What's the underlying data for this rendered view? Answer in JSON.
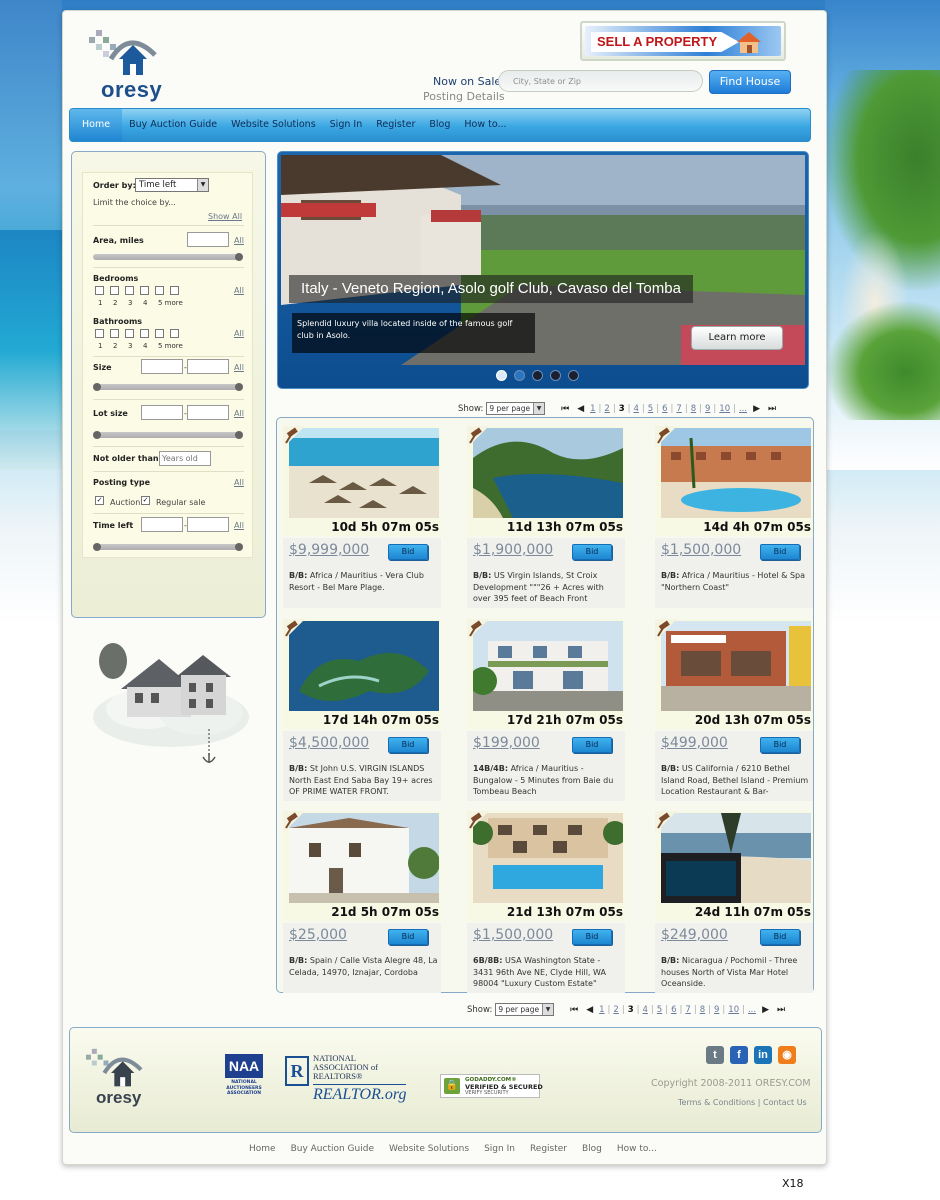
{
  "header": {
    "logo_text": "oresy",
    "sell_banner": "SELL A PROPERTY",
    "now_on_sale": "Now on Sale",
    "posting_details": "Posting Details",
    "search_placeholder": "City, State or Zip",
    "find_button": "Find House"
  },
  "nav": [
    "Home",
    "Buy Auction Guide",
    "Website Solutions",
    "Sign In",
    "Register",
    "Blog",
    "How to..."
  ],
  "filters": {
    "order_by_label": "Order by:",
    "order_by_value": "Time left",
    "limit_text": "Limit the choice by...",
    "show_all": "Show All",
    "area_label": "Area, miles",
    "all": "All",
    "bedrooms_label": "Bedrooms",
    "bathrooms_label": "Bathrooms",
    "count_nums": [
      "1",
      "2",
      "3",
      "4",
      "5 more"
    ],
    "size_label": "Size",
    "lot_size_label": "Lot size",
    "not_older_label": "Not older than:",
    "not_older_placeholder": "Years old",
    "posting_type_label": "Posting type",
    "auction_label": "Auction",
    "regular_label": "Regular sale",
    "time_left_label": "Time left",
    "dash": "-"
  },
  "hero": {
    "caption": "Italy - Veneto Region, Asolo golf Club, Cavaso del Tomba",
    "description": "Splendid luxury villa located inside of the famous golf club in Asolo.",
    "button": "Learn more",
    "slide_count": 5,
    "active_slide": 1
  },
  "pager": {
    "show_label": "Show:",
    "per_page": "9 per page",
    "first": "⏮",
    "prev": "◀",
    "next": "▶",
    "last": "⏭",
    "pages": [
      "1",
      "2",
      "3",
      "4",
      "5",
      "6",
      "7",
      "8",
      "9",
      "10",
      "..."
    ],
    "current_page": "3"
  },
  "listings": [
    {
      "timer": "10d 5h 07m 05s",
      "price": "$9,999,000",
      "code": "B/B:",
      "desc": "Africa / Mauritius - Vera Club Resort - Bel Mare Plage.",
      "scene": "beach-umbrellas"
    },
    {
      "timer": "11d 13h 07m 05s",
      "price": "$1,900,000",
      "code": "B/B:",
      "desc": "US Virgin Islands, St Croix Development \"\"\"26 + Acres with over 395 feet of Beach Front",
      "scene": "bay"
    },
    {
      "timer": "14d 4h 07m 05s",
      "price": "$1,500,000",
      "code": "B/B:",
      "desc": "Africa / Mauritius - Hotel & Spa \"Northern Coast\"",
      "scene": "hotel-pool"
    },
    {
      "timer": "17d 14h 07m 05s",
      "price": "$4,500,000",
      "code": "B/B:",
      "desc": "St John U.S. VIRGIN ISLANDS North East End Saba Bay 19+ acres OF PRIME WATER FRONT.",
      "scene": "aerial-island"
    },
    {
      "timer": "17d 21h 07m 05s",
      "price": "$199,000",
      "code": "14B/4B:",
      "desc": "Africa / Mauritius - Bungalow - 5 Minutes from Baie du Tombeau Beach",
      "scene": "bungalow"
    },
    {
      "timer": "20d 13h 07m 05s",
      "price": "$499,000",
      "code": "B/B:",
      "desc": "US California / 6210 Bethel Island Road, Bethel Island - Premium Location Restaurant & Bar-",
      "scene": "restaurant"
    },
    {
      "timer": "21d 5h 07m 05s",
      "price": "$25,000",
      "code": "B/B:",
      "desc": "Spain / Calle Vista Alegre 48, La Celada, 14970, Iznajar, Cordoba",
      "scene": "white-house"
    },
    {
      "timer": "21d 13h 07m 05s",
      "price": "$1,500,000",
      "code": "6B/8B:",
      "desc": "USA Washington State - 3431 96th Ave NE, Clyde Hill, WA 98004 \"Luxury Custom Estate\"",
      "scene": "estate-pool"
    },
    {
      "timer": "24d 11h 07m 05s",
      "price": "$249,000",
      "code": "B/B:",
      "desc": "Nicaragua / Pochomil - Three houses North of Vista Mar Hotel Oceanside.",
      "scene": "ocean-jacuzzi"
    }
  ],
  "bid_label": "Bid",
  "footer": {
    "logo_text": "oresy",
    "naa": "NAA",
    "naa_sub": "NATIONAL AUCTIONEERS ASSOCIATION",
    "nar_line1": "NATIONAL",
    "nar_line2": "ASSOCIATION of",
    "nar_line3": "REALTORS®",
    "nar_org": "REALTOR.org",
    "godaddy_l1": "GODADDY.COM®",
    "godaddy_l2": "VERIFIED & SECURED",
    "godaddy_l3": "VERIFY SECURITY",
    "copyright": "Copyright 2008-2011 ORESY.COM",
    "terms": "Terms & Conditions",
    "sep": "|",
    "contact": "Contact Us",
    "social": [
      {
        "name": "twitter-icon",
        "glyph": "t",
        "color": "#6b7b85"
      },
      {
        "name": "facebook-icon",
        "glyph": "f",
        "color": "#2a63b5"
      },
      {
        "name": "linkedin-icon",
        "glyph": "in",
        "color": "#1c74b8"
      },
      {
        "name": "rss-icon",
        "glyph": "◉",
        "color": "#f07d1b"
      }
    ]
  },
  "bottom_nav": [
    "Home",
    "Buy Auction Guide",
    "Website Solutions",
    "Sign In",
    "Register",
    "Blog",
    "How to..."
  ],
  "page_tag": "X18"
}
